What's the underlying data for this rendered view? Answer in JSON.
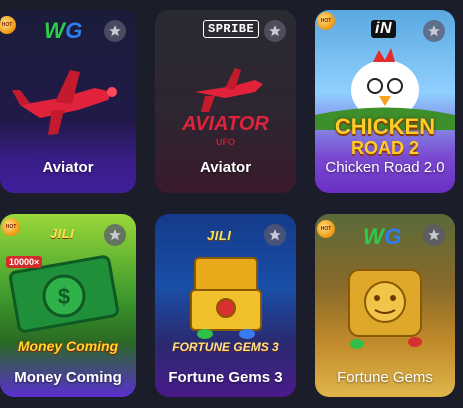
{
  "cards": [
    {
      "title": "Aviator",
      "provider": "WG",
      "hot": true
    },
    {
      "title": "Aviator",
      "provider": "SPRIBE",
      "logo": "Aviator",
      "logo_sub": "UFO"
    },
    {
      "title": "Chicken Road 2.0",
      "provider": "iN",
      "hot": true,
      "logo_line1": "CHICKEN",
      "logo_line2": "ROAD 2"
    },
    {
      "title": "Money Coming",
      "provider": "JILI",
      "hot": true,
      "logo": "Money Coming",
      "badge": "10000×"
    },
    {
      "title": "Fortune Gems 3",
      "provider": "JILI",
      "logo": "FORTUNE GEMS 3"
    },
    {
      "title": "Fortune Gems",
      "provider": "WG",
      "hot": true
    }
  ],
  "icons": {
    "favorite": "star-icon",
    "hot": "hot-badge-icon"
  },
  "colors": {
    "page_bg": "#1b1d2a",
    "card1_footer": "#4c1fb8",
    "card2_footer": "#3a1a2c",
    "card3_footer": "#6a2fc4",
    "card4_footer": "#5a2fcf",
    "card5_footer": "#4a1a8a",
    "card6_footer": "#e0b64a"
  }
}
